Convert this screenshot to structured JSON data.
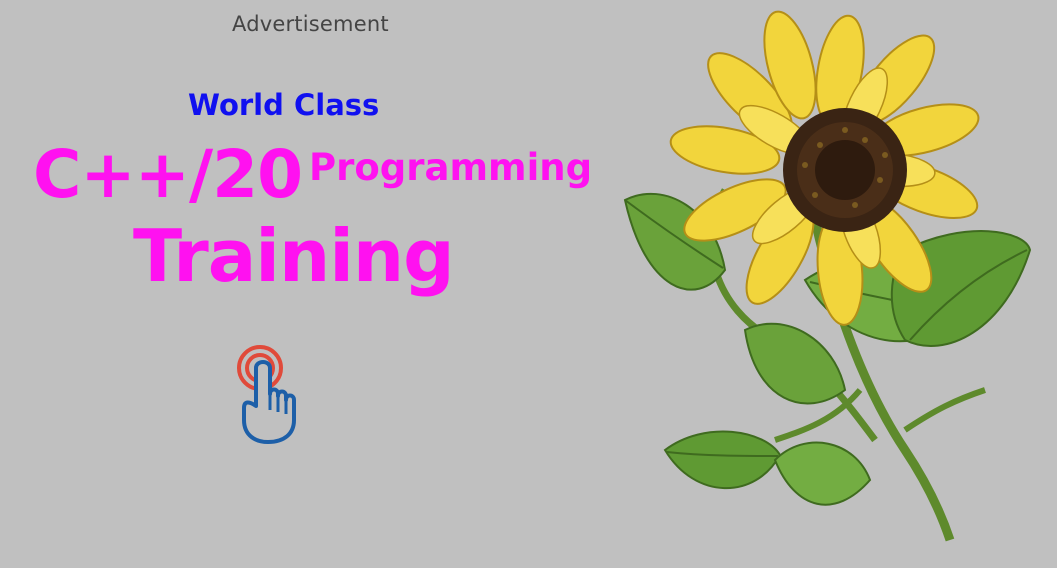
{
  "ad": {
    "label": "Advertisement",
    "line1": "World Class",
    "line2": "C++/20",
    "line2b": "Programming",
    "line3": "Training"
  },
  "icons": {
    "tap": "tap-hand-icon",
    "flower": "sunflower-image"
  },
  "colors": {
    "background": "#c0c0c0",
    "headline": "#ff11f0",
    "subhead": "#1010f0",
    "label": "#444444"
  }
}
